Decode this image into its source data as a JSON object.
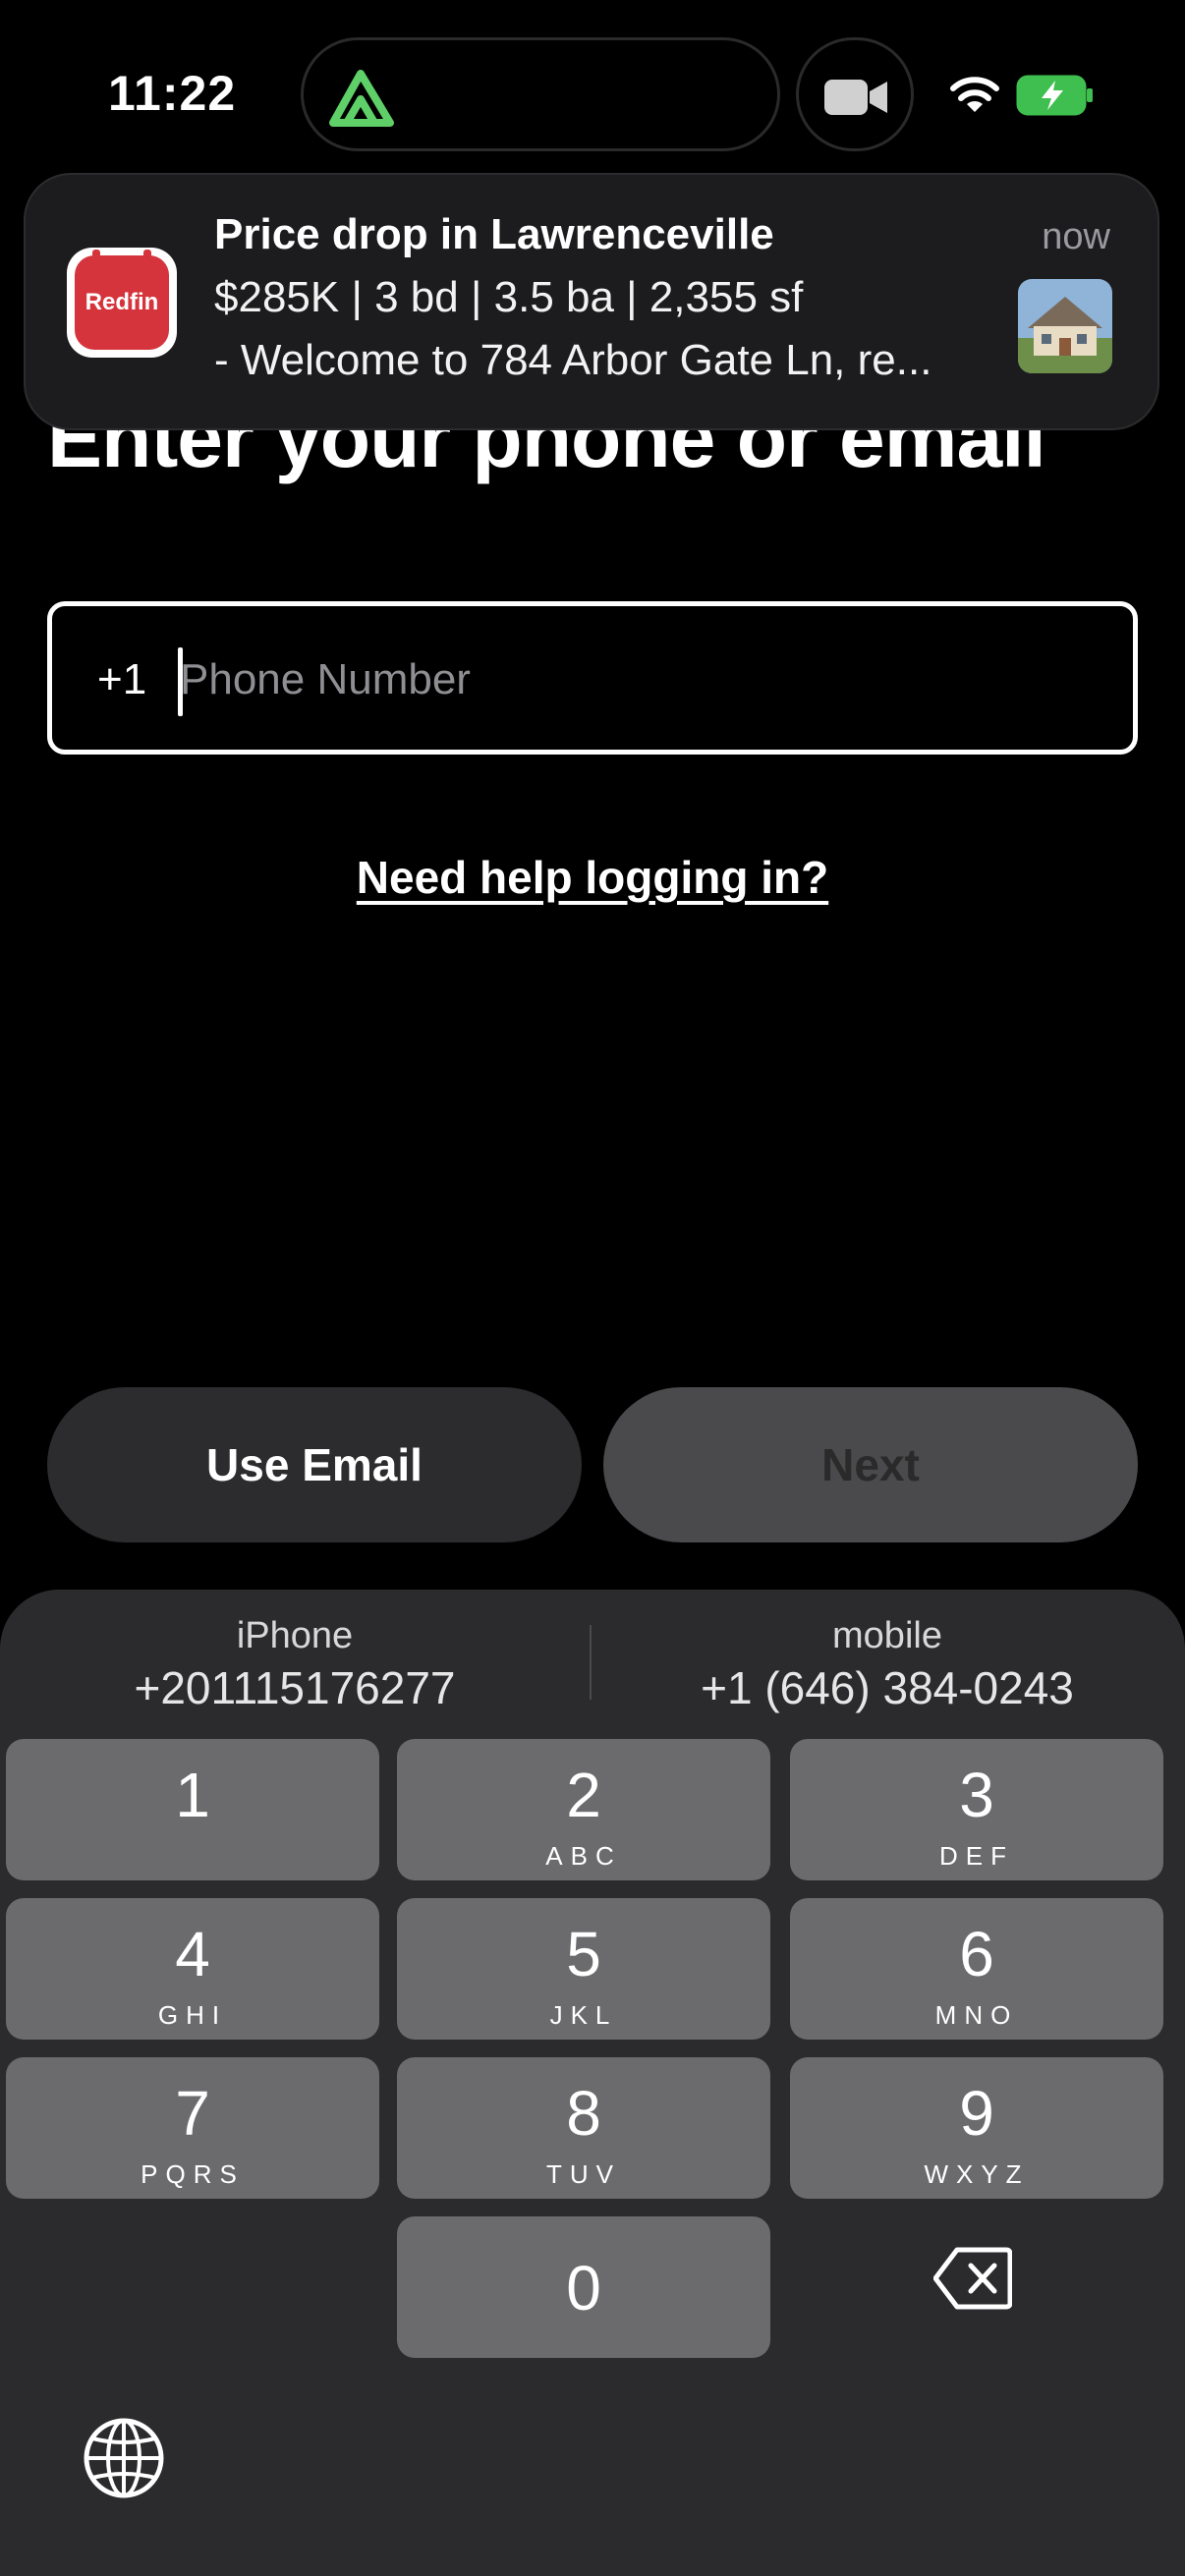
{
  "status_bar": {
    "time": "11:22"
  },
  "notification": {
    "app_name": "Redfin",
    "title": "Price drop in Lawrenceville",
    "line1": "$285K | 3 bd | 3.5 ba | 2,355 sf",
    "line2": "- Welcome to 784 Arbor Gate Ln, re...",
    "time": "now"
  },
  "page": {
    "heading": "Enter your phone or email",
    "phone_prefix": "+1",
    "phone_placeholder": "Phone Number",
    "help_link": "Need help logging in?"
  },
  "actions": {
    "use_email": "Use Email",
    "next": "Next"
  },
  "keyboard": {
    "suggestions": [
      {
        "label": "iPhone",
        "number": "+201115176277"
      },
      {
        "label": "mobile",
        "number": "+1 (646) 384-0243"
      }
    ],
    "keys": [
      {
        "digit": "1",
        "letters": ""
      },
      {
        "digit": "2",
        "letters": "ABC"
      },
      {
        "digit": "3",
        "letters": "DEF"
      },
      {
        "digit": "4",
        "letters": "GHI"
      },
      {
        "digit": "5",
        "letters": "JKL"
      },
      {
        "digit": "6",
        "letters": "MNO"
      },
      {
        "digit": "7",
        "letters": "PQRS"
      },
      {
        "digit": "8",
        "letters": "TUV"
      },
      {
        "digit": "9",
        "letters": "WXYZ"
      },
      {
        "digit": "0",
        "letters": ""
      }
    ]
  },
  "colors": {
    "background": "#000000",
    "app_icon": "#d5343c",
    "keyboard_bg": "#2b2b2d",
    "key_bg": "#6b6b6d",
    "peak_icon": "#5fd068"
  }
}
